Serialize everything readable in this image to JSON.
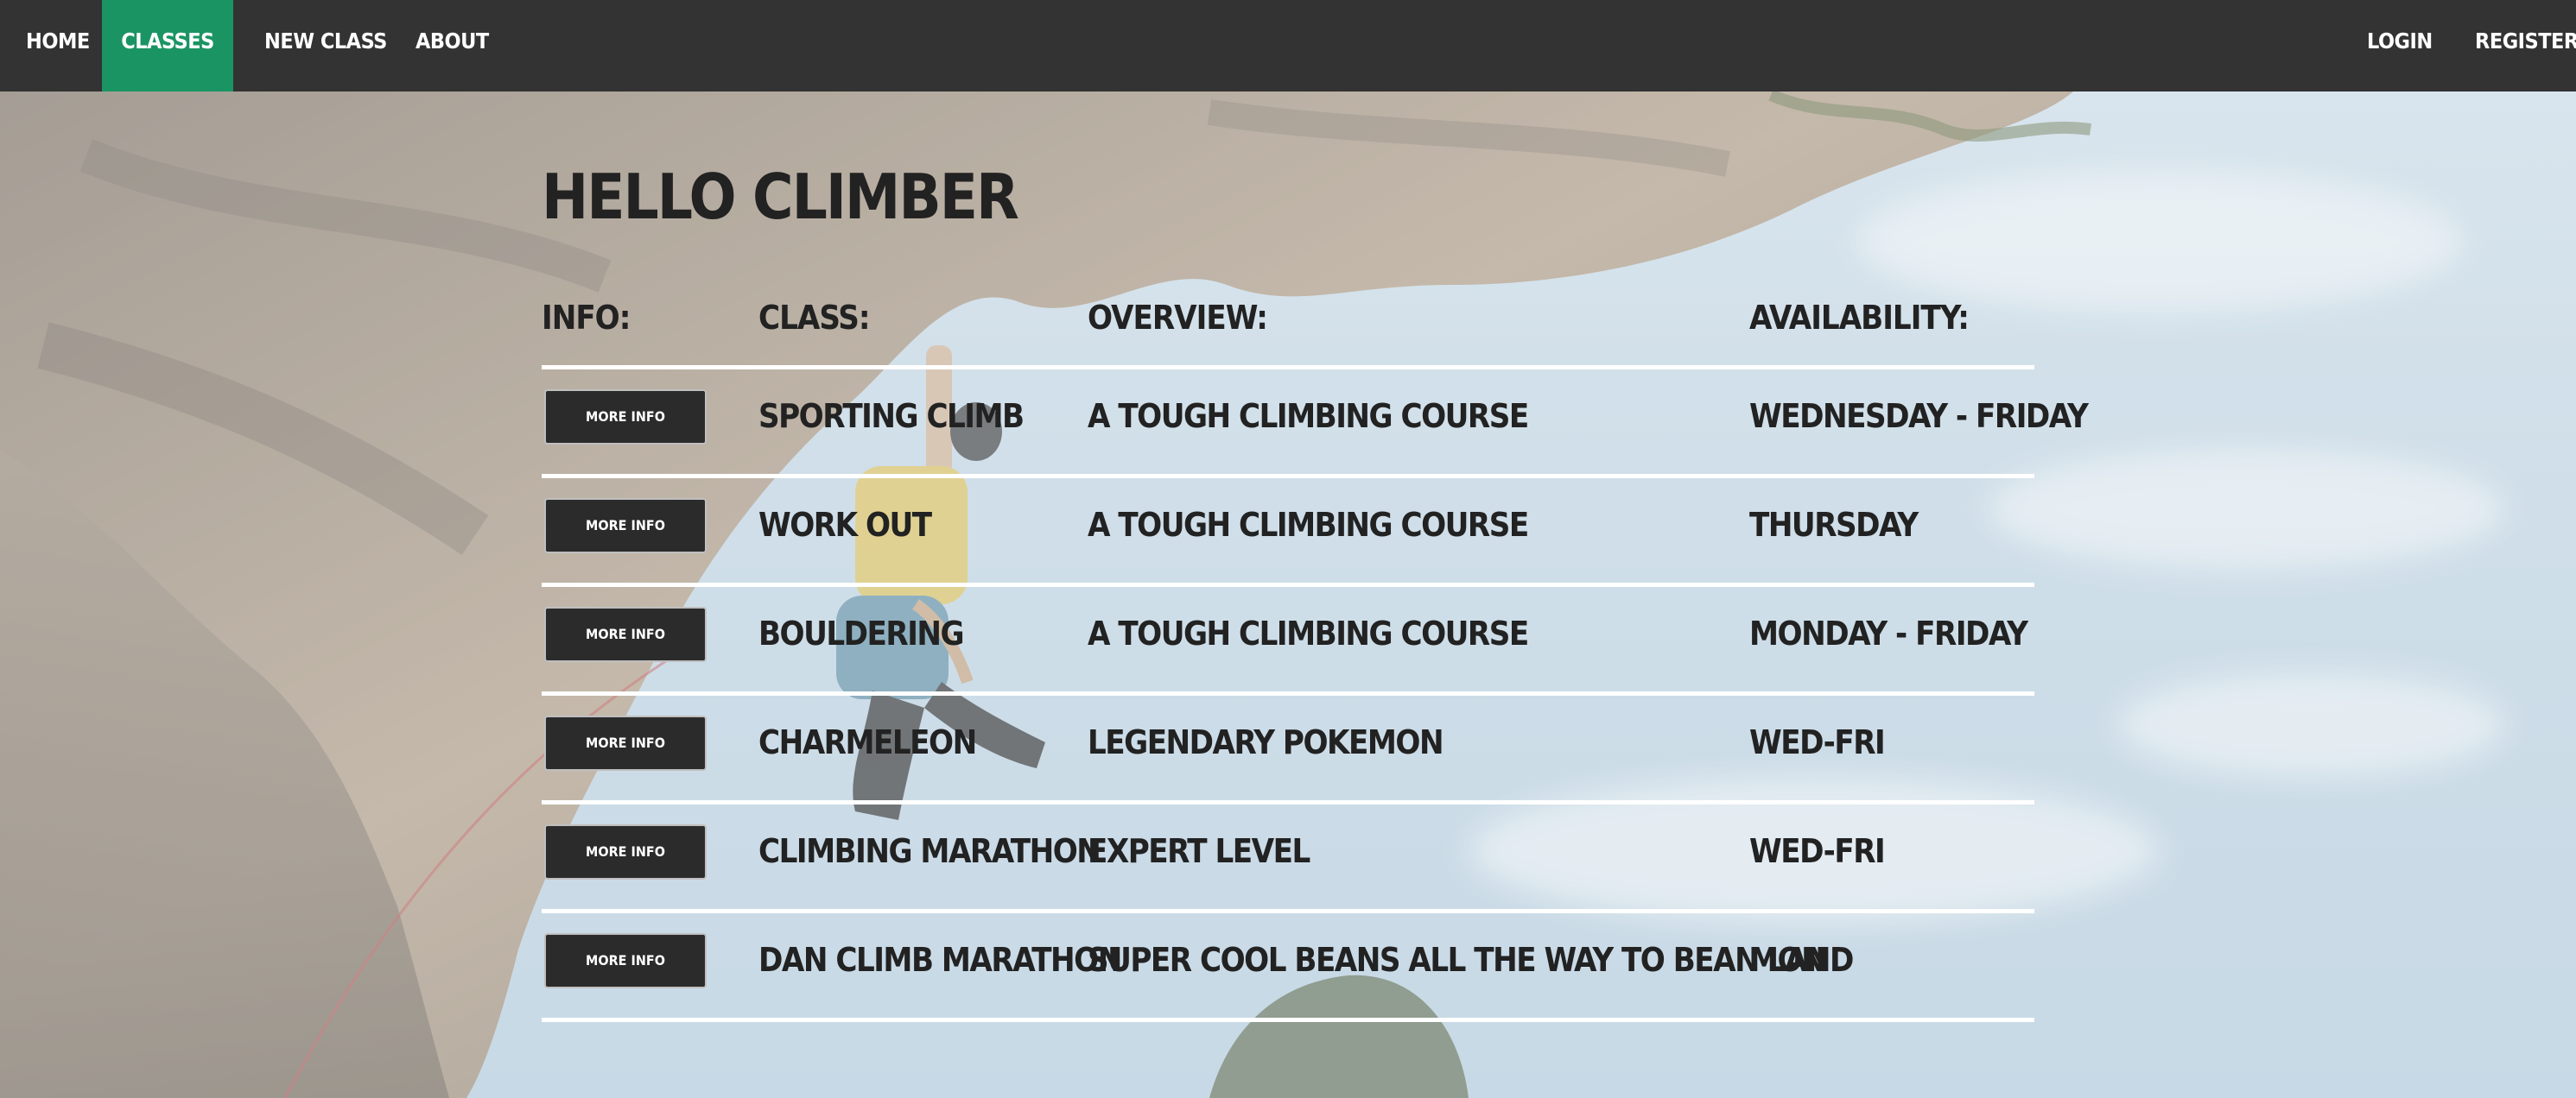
{
  "nav": {
    "home": "HOME",
    "classes": "CLASSES",
    "new_class": "NEW CLASS",
    "about": "ABOUT",
    "login": "LOGIN",
    "register": "REGISTER",
    "active": "classes",
    "active_color": "#1a9463",
    "bar_color": "#333333"
  },
  "page": {
    "title": "HELLO CLIMBER"
  },
  "table": {
    "headers": {
      "info": "INFO:",
      "class": "CLASS:",
      "overview": "OVERVIEW:",
      "availability": "AVAILABILITY:"
    },
    "rows": [
      {
        "button": "MORE INFO",
        "class": "SPORTING CLIMB",
        "overview": "A TOUGH CLIMBING COURSE",
        "availability": "WEDNESDAY - FRIDAY"
      },
      {
        "button": "MORE INFO",
        "class": "WORK OUT",
        "overview": "A TOUGH CLIMBING COURSE",
        "availability": "THURSDAY"
      },
      {
        "button": "MORE INFO",
        "class": "BOULDERING",
        "overview": "A TOUGH CLIMBING COURSE",
        "availability": "MONDAY - FRIDAY"
      },
      {
        "button": "MORE INFO",
        "class": "CHARMELEON",
        "overview": "LEGENDARY POKEMON",
        "availability": "WED-FRI"
      },
      {
        "button": "MORE INFO",
        "class": "CLIMBING MARATHON",
        "overview": "EXPERT LEVEL",
        "availability": "WED-FRI"
      },
      {
        "button": "MORE INFO",
        "class": "DAN CLIMB MARATHON",
        "overview": "SUPER COOL BEANS ALL THE WAY TO BEAN LAND",
        "availability": "MON"
      }
    ]
  }
}
